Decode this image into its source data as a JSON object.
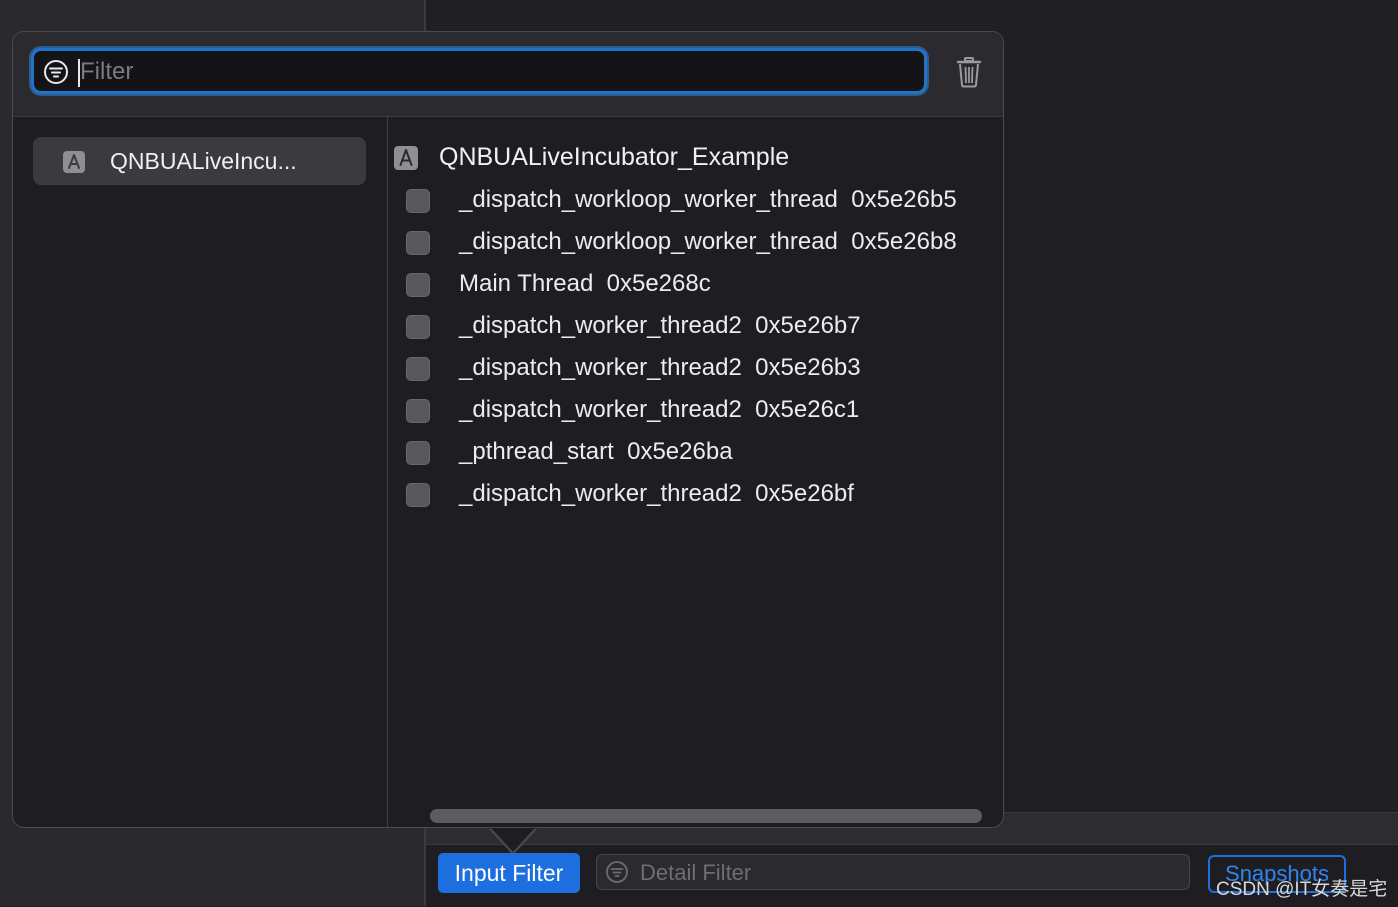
{
  "filter": {
    "placeholder": "Filter",
    "value": ""
  },
  "sidebar": {
    "items": [
      {
        "label": "QNBUALiveIncu...",
        "icon": "app-icon"
      }
    ]
  },
  "process": {
    "name": "QNBUALiveIncubator_Example",
    "icon": "app-icon"
  },
  "threads": [
    {
      "label": "_dispatch_workloop_worker_thread  0x5e26b5",
      "checked": false
    },
    {
      "label": "_dispatch_workloop_worker_thread  0x5e26b8",
      "checked": false
    },
    {
      "label": "Main Thread  0x5e268c",
      "checked": false
    },
    {
      "label": "_dispatch_worker_thread2  0x5e26b7",
      "checked": false
    },
    {
      "label": "_dispatch_worker_thread2  0x5e26b3",
      "checked": false
    },
    {
      "label": "_dispatch_worker_thread2  0x5e26c1",
      "checked": false
    },
    {
      "label": "_pthread_start  0x5e26ba",
      "checked": false
    },
    {
      "label": "_dispatch_worker_thread2  0x5e26bf",
      "checked": false
    }
  ],
  "bottom_bar": {
    "input_filter_label": "Input Filter",
    "detail_filter_placeholder": "Detail Filter",
    "snapshots_label": "Snapshots"
  },
  "watermark": "CSDN @IT女奏是宅",
  "colors": {
    "accent": "#1d6fe0",
    "focus_ring": "#1f74c7"
  }
}
